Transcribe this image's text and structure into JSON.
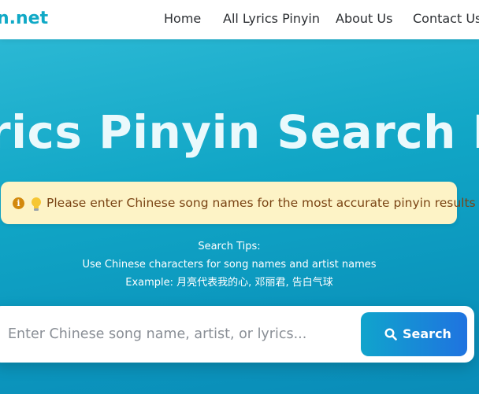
{
  "brand": {
    "text": "n.net"
  },
  "nav": {
    "items": [
      {
        "label": "Home"
      },
      {
        "label": "All Lyrics Pinyin"
      },
      {
        "label": "About Us"
      },
      {
        "label": "Contact Us"
      }
    ]
  },
  "hero": {
    "title": "rics Pinyin Search Engi",
    "notice": {
      "icons": [
        "info-icon",
        "lightbulb-icon"
      ],
      "text": "Please enter Chinese song names for the most accurate pinyin results"
    },
    "tips": {
      "heading": "Search Tips:",
      "line1": "Use Chinese characters for song names and artist names",
      "line2": "Example: 月亮代表我的心, 邓丽君, 告白气球"
    }
  },
  "search": {
    "placeholder": "Enter Chinese song name, artist, or lyrics...",
    "value": "",
    "button_label": "Search",
    "button_icon": "search-icon"
  },
  "colors": {
    "brand": "#10a9c6",
    "hero_gradient_start": "#2bb8d4",
    "hero_gradient_end": "#0a8cb8",
    "notice_background": "#fdf3c6",
    "notice_text": "#7a4414",
    "button_gradient_start": "#10a4cc",
    "button_gradient_end": "#1f73e0"
  }
}
